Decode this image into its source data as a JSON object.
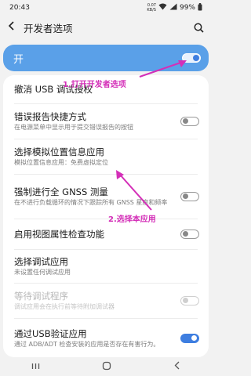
{
  "status_bar": {
    "time": "20:43",
    "speed_value": "0.07",
    "speed_unit": "KB/S",
    "battery": "99%"
  },
  "header": {
    "title": "开发者选项"
  },
  "master": {
    "label": "开",
    "enabled": true
  },
  "items": [
    {
      "title": "撤消 USB 调试授权",
      "subtitle": ""
    },
    {
      "title": "错误报告快捷方式",
      "subtitle": "在电源菜单中显示用于提交错误报告的按钮",
      "toggle": "off"
    },
    {
      "title": "选择模拟位置信息应用",
      "subtitle": "模拟位置信息应用：免费虚拟定位"
    },
    {
      "title": "强制进行全 GNSS 测量",
      "subtitle": "在不进行负载循环的情况下跟踪所有 GNSS 星座和频率",
      "toggle": "off"
    },
    {
      "title": "启用视图属性检查功能",
      "subtitle": "",
      "toggle": "off"
    },
    {
      "title": "选择调试应用",
      "subtitle": "未设置任何调试应用"
    },
    {
      "title": "等待调试程序",
      "subtitle": "调试应用会在执行前等待附加调试器",
      "toggle": "disabled"
    },
    {
      "title": "通过USB验证应用",
      "subtitle": "通过 ADB/ADT 检查安装的应用是否存在有害行为。",
      "toggle": "on"
    }
  ],
  "annotations": {
    "step1": "1.打开开发者选项",
    "step2": "2.选择本应用"
  },
  "colors": {
    "accent": "#3e7ee0",
    "master_card": "#5aa0e8",
    "annotation": "#d42fb8"
  }
}
